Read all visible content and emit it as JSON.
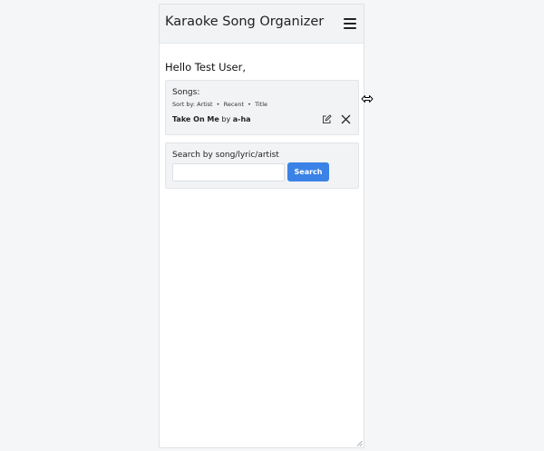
{
  "app": {
    "title": "Karaoke Song Organizer",
    "menu_icon": "hamburger-menu-icon"
  },
  "greeting": "Hello Test User,",
  "songs": {
    "label": "Songs:",
    "sort_prefix": "Sort by:",
    "sort_options": [
      "Artist",
      "Recent",
      "Title"
    ],
    "separator": "•",
    "items": [
      {
        "title": "Take On Me",
        "by": "by",
        "artist": "a-ha",
        "edit_icon": "edit-icon",
        "delete_icon": "close-icon"
      }
    ]
  },
  "search": {
    "label": "Search by song/lyric/artist",
    "value": "",
    "placeholder": "",
    "button_label": "Search"
  },
  "colors": {
    "accent": "#3b82e6",
    "card_bg": "#f1f3f5",
    "header_bg": "#f1f3f5"
  }
}
